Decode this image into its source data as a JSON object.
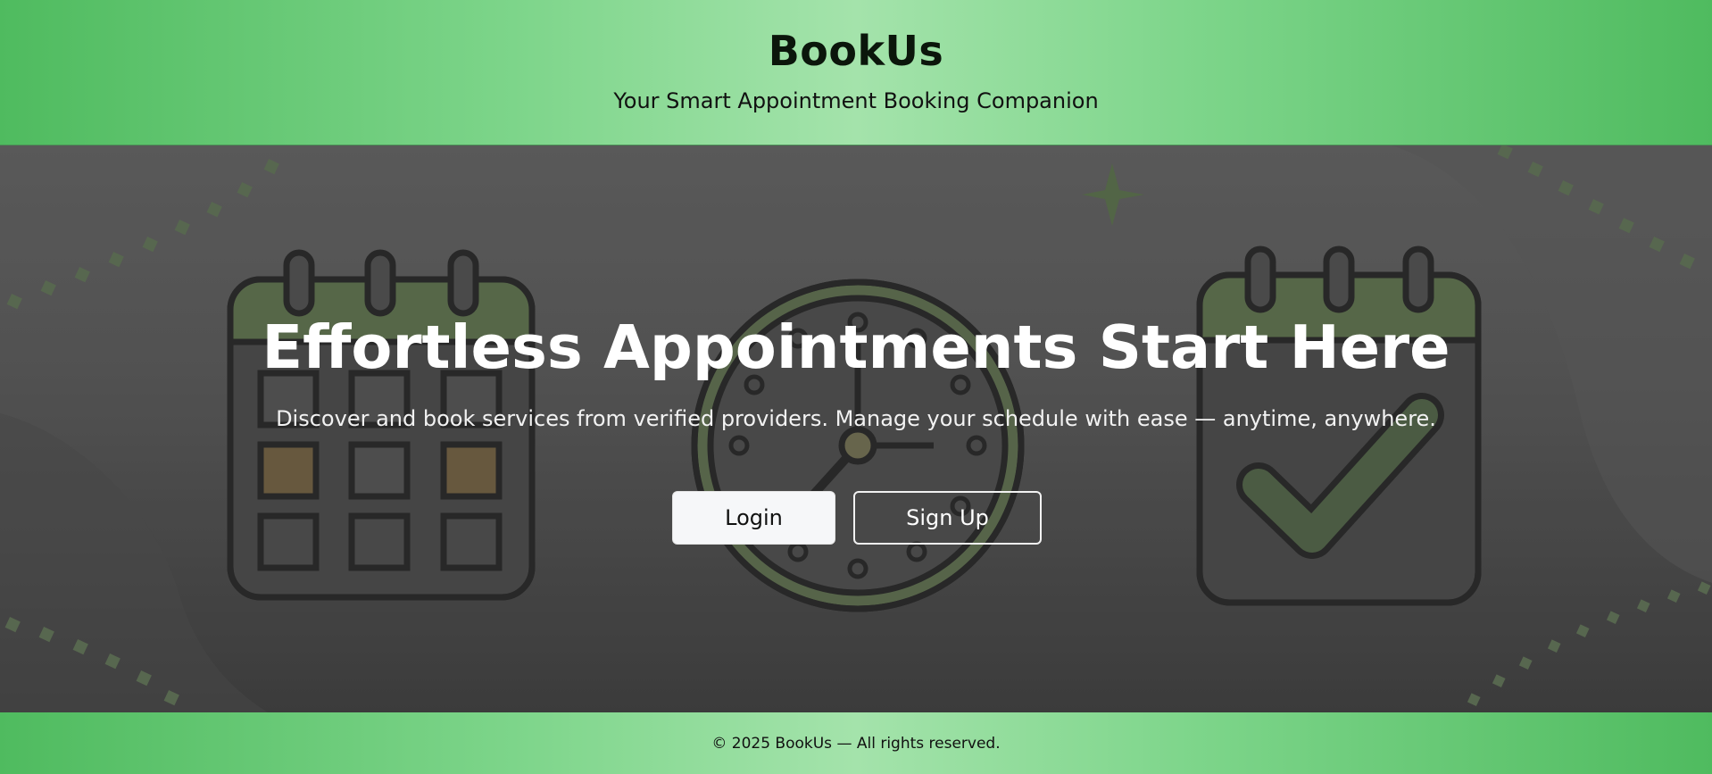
{
  "header": {
    "brand": "BookUs",
    "tagline": "Your Smart Appointment Booking Companion"
  },
  "hero": {
    "title": "Effortless Appointments Start Here",
    "subtitle": "Discover and book services from verified providers. Manage your schedule with ease — anytime, anywhere.",
    "background_icons": [
      "calendar-icon",
      "clock-icon",
      "calendar-check-icon",
      "sparkle-icon"
    ]
  },
  "actions": {
    "login_label": "Login",
    "signup_label": "Sign Up"
  },
  "footer": {
    "copyright": "© 2025 BookUs — All rights reserved."
  },
  "colors": {
    "brand_green": "#4fbb5f",
    "brand_green_light": "#a4e3ab",
    "hero_overlay": "#555555",
    "icon_green": "#5f7a4c"
  }
}
